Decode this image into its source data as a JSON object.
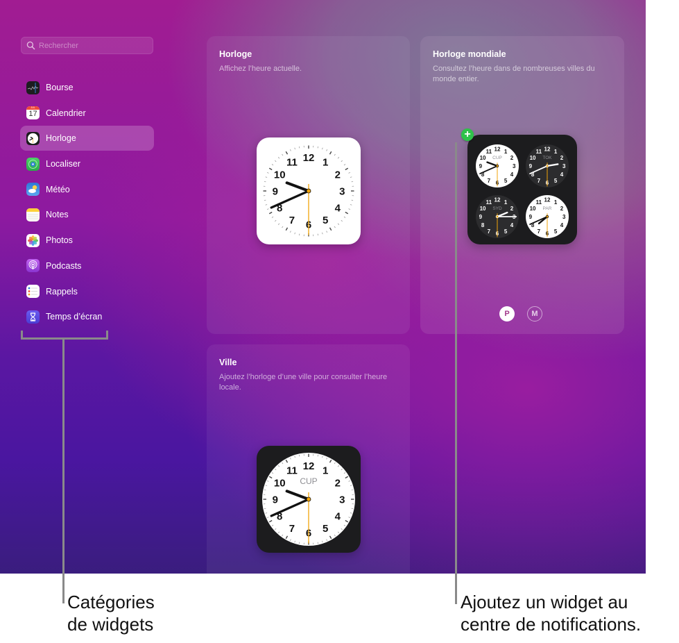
{
  "sidebar": {
    "search_placeholder": "Rechercher",
    "categories": [
      {
        "label": "Bourse",
        "icon": "stocks-icon",
        "selected": false
      },
      {
        "label": "Calendrier",
        "icon": "calendar-icon",
        "selected": false,
        "icon_month": "JUL",
        "icon_day": "17"
      },
      {
        "label": "Horloge",
        "icon": "clock-icon",
        "selected": true
      },
      {
        "label": "Localiser",
        "icon": "find-my-icon",
        "selected": false
      },
      {
        "label": "Météo",
        "icon": "weather-icon",
        "selected": false
      },
      {
        "label": "Notes",
        "icon": "notes-icon",
        "selected": false
      },
      {
        "label": "Photos",
        "icon": "photos-icon",
        "selected": false
      },
      {
        "label": "Podcasts",
        "icon": "podcasts-icon",
        "selected": false
      },
      {
        "label": "Rappels",
        "icon": "reminders-icon",
        "selected": false
      },
      {
        "label": "Temps d’écran",
        "icon": "screen-time-icon",
        "selected": false
      }
    ]
  },
  "widgets": {
    "horloge": {
      "title": "Horloge",
      "description": "Affichez l’heure actuelle.",
      "time": {
        "hour": 9,
        "minute": 41,
        "second": 30
      }
    },
    "mondiale": {
      "title": "Horloge mondiale",
      "description": "Consultez l’heure dans de nombreuses villes du monde entier.",
      "add_label": "+",
      "cities": [
        {
          "code": "CUP",
          "theme": "light",
          "hour": 9,
          "minute": 41
        },
        {
          "code": "TOK",
          "theme": "dark",
          "hour": 2,
          "minute": 41
        },
        {
          "code": "SYD",
          "theme": "dark",
          "hour": 2,
          "minute": 15
        },
        {
          "code": "PAR",
          "theme": "light",
          "hour": 7,
          "minute": 41
        }
      ],
      "sizes": [
        {
          "label": "P",
          "active": true
        },
        {
          "label": "M",
          "active": false
        }
      ]
    },
    "ville": {
      "title": "Ville",
      "description": "Ajoutez l’horloge d’une ville pour consulter l’heure locale.",
      "city_code": "CUP",
      "time": {
        "hour": 9,
        "minute": 41,
        "second": 30
      }
    }
  },
  "callouts": {
    "left": [
      "Catégories",
      "de widgets"
    ],
    "right": [
      "Ajoutez un widget au",
      "centre de notifications."
    ]
  },
  "colors": {
    "second_hand": "#f0a30a",
    "add_button": "#2fc24a"
  }
}
